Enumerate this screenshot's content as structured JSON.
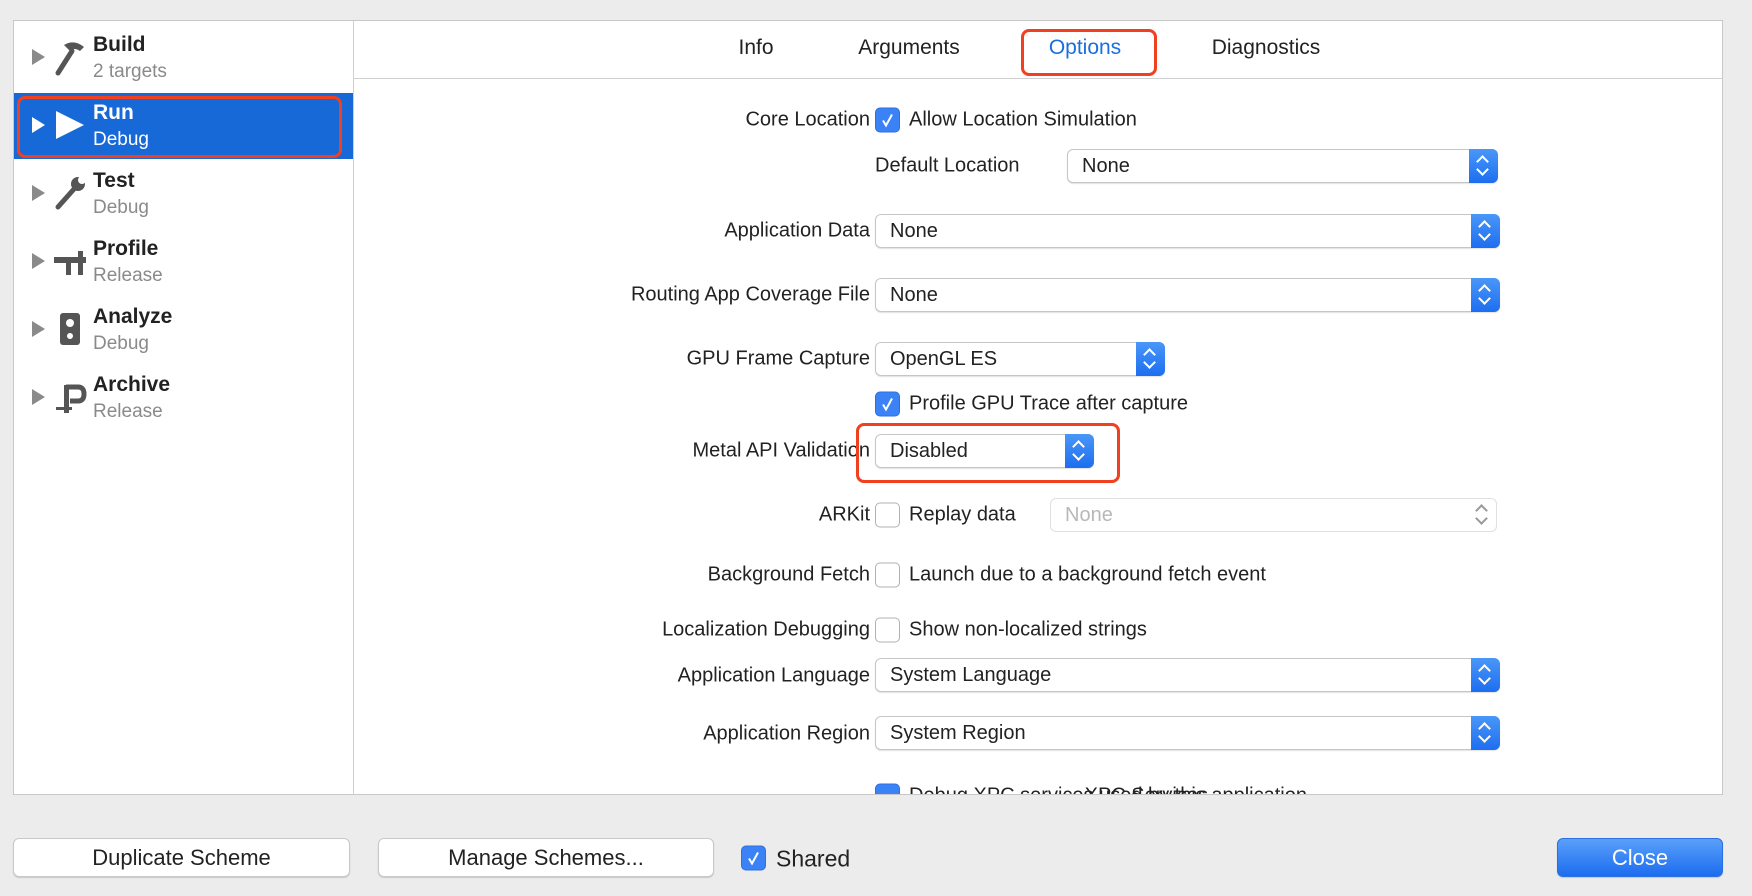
{
  "sidebar": {
    "items": [
      {
        "title": "Build",
        "subtitle": "2 targets",
        "icon": "hammer-icon",
        "selected": false
      },
      {
        "title": "Run",
        "subtitle": "Debug",
        "icon": "play-icon",
        "selected": true
      },
      {
        "title": "Test",
        "subtitle": "Debug",
        "icon": "wrench-icon",
        "selected": false
      },
      {
        "title": "Profile",
        "subtitle": "Release",
        "icon": "caliper-icon",
        "selected": false
      },
      {
        "title": "Analyze",
        "subtitle": "Debug",
        "icon": "gauge-icon",
        "selected": false
      },
      {
        "title": "Archive",
        "subtitle": "Release",
        "icon": "clamp-icon",
        "selected": false
      }
    ]
  },
  "tabs": [
    {
      "label": "Info"
    },
    {
      "label": "Arguments"
    },
    {
      "label": "Options",
      "active": true
    },
    {
      "label": "Diagnostics"
    }
  ],
  "options": {
    "core_location": {
      "label": "Core Location",
      "checkbox": "Allow Location Simulation",
      "checked": true
    },
    "default_location": {
      "label": "Default Location",
      "value": "None"
    },
    "application_data": {
      "label": "Application Data",
      "value": "None"
    },
    "routing": {
      "label": "Routing App Coverage File",
      "value": "None"
    },
    "gpu_frame_capture": {
      "label": "GPU Frame Capture",
      "value": "OpenGL ES"
    },
    "profile_gpu": {
      "checkbox": "Profile GPU Trace after capture",
      "checked": true
    },
    "metal_api": {
      "label": "Metal API Validation",
      "value": "Disabled"
    },
    "arkit": {
      "label": "ARKit",
      "checkbox": "Replay data",
      "checked": false,
      "value": "None"
    },
    "background_fetch": {
      "label": "Background Fetch",
      "checkbox": "Launch due to a background fetch event",
      "checked": false
    },
    "localization": {
      "label": "Localization Debugging",
      "checkbox": "Show non-localized strings",
      "checked": false
    },
    "app_language": {
      "label": "Application Language",
      "value": "System Language"
    },
    "app_region": {
      "label": "Application Region",
      "value": "System Region"
    },
    "xpc": {
      "label": "XPC Services",
      "checkbox": "Debug XPC services used by this application",
      "checked": true
    }
  },
  "footer": {
    "duplicate": "Duplicate Scheme",
    "manage": "Manage Schemes...",
    "shared": "Shared",
    "shared_checked": true,
    "close": "Close"
  },
  "colors": {
    "accent": "#1769d8",
    "highlight": "#f0401e"
  }
}
